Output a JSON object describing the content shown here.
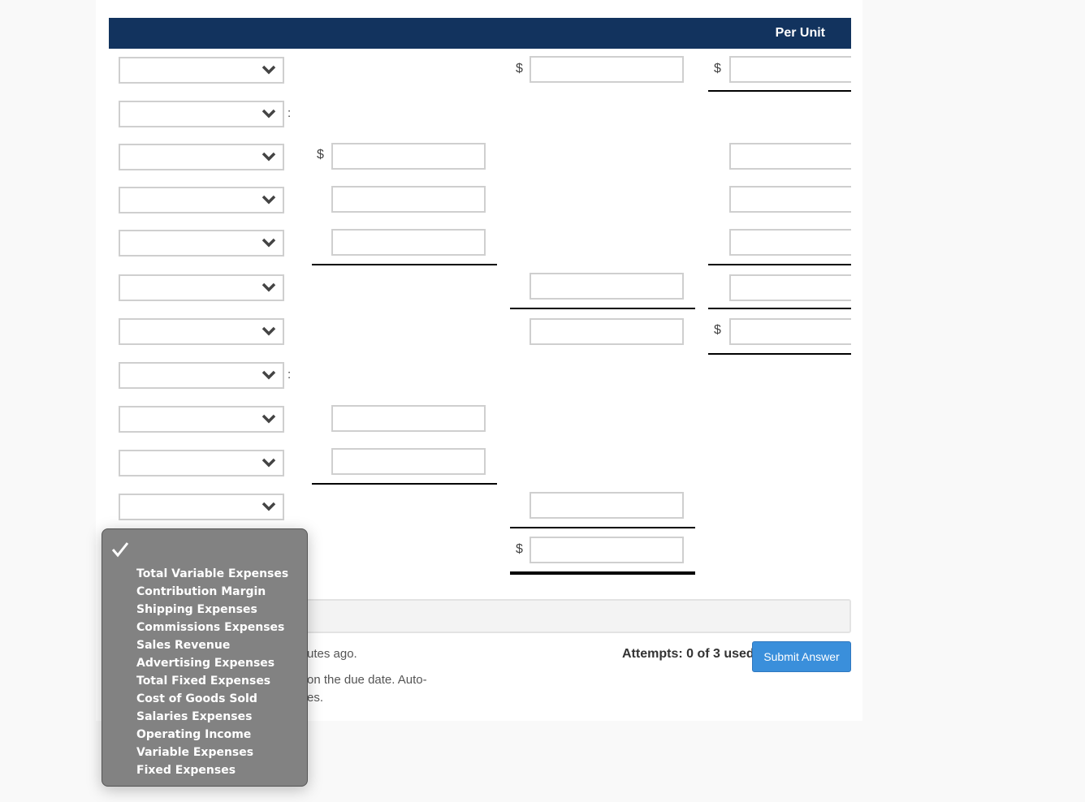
{
  "header": {
    "per_unit_label": "Per Unit"
  },
  "currency_symbol": "$",
  "colon": ":",
  "rows": [
    {
      "select_value": "",
      "has_colon": false,
      "col1": null,
      "col2": "",
      "col3": ""
    },
    {
      "select_value": "",
      "has_colon": true,
      "col1": null,
      "col2": null,
      "col3": null
    },
    {
      "select_value": "",
      "has_colon": false,
      "col1": "",
      "col2": null,
      "col3": ""
    },
    {
      "select_value": "",
      "has_colon": false,
      "col1": "",
      "col2": null,
      "col3": ""
    },
    {
      "select_value": "",
      "has_colon": false,
      "col1": "",
      "col2": null,
      "col3": ""
    },
    {
      "select_value": "",
      "has_colon": false,
      "col1": null,
      "col2": "",
      "col3": ""
    },
    {
      "select_value": "",
      "has_colon": false,
      "col1": null,
      "col2": "",
      "col3": ""
    },
    {
      "select_value": "",
      "has_colon": true,
      "col1": null,
      "col2": null,
      "col3": null
    },
    {
      "select_value": "",
      "has_colon": false,
      "col1": "",
      "col2": null,
      "col3": null
    },
    {
      "select_value": "",
      "has_colon": false,
      "col1": "",
      "col2": null,
      "col3": null
    },
    {
      "select_value": "",
      "has_colon": false,
      "col1": null,
      "col2": "",
      "col3": null
    },
    {
      "select_value": null,
      "has_colon": false,
      "col1": null,
      "col2": "",
      "col3": null
    }
  ],
  "dropdown": {
    "selected_option": "",
    "options": [
      "Total Variable Expenses",
      "Contribution Margin",
      "Shipping Expenses",
      "Commissions Expenses",
      "Sales Revenue",
      "Advertising Expenses",
      "Total Fixed Expenses",
      "Cost of Goods Sold",
      "Salaries Expenses",
      "Operating Income",
      "Variable Expenses",
      "Fixed Expenses"
    ]
  },
  "footer": {
    "note_line1_fragment": "utes ago.",
    "note_line2_fragment": "on the due date. Auto-",
    "note_line3_fragment": "es.",
    "attempts": "Attempts: 0 of 3 used",
    "submit_label": "Submit Answer"
  },
  "colors": {
    "header_bg": "#12335e",
    "submit_bg": "#3a8fdb",
    "popup_bg": "#828282"
  }
}
